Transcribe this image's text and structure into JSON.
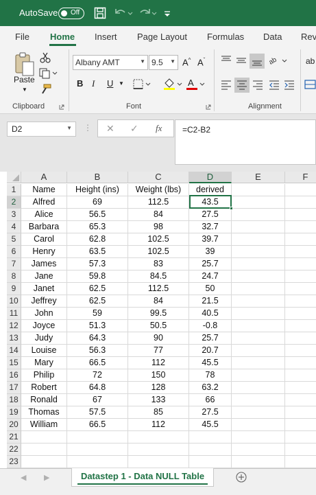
{
  "titlebar": {
    "autosave_label": "AutoSave",
    "toggle_state": "Off"
  },
  "ribbon_tabs": [
    "File",
    "Home",
    "Insert",
    "Page Layout",
    "Formulas",
    "Data",
    "Rev"
  ],
  "active_tab": "Home",
  "ribbon": {
    "paste_label": "Paste",
    "font_name": "Albany AMT",
    "font_size": "9.5",
    "bold": "B",
    "italic": "I",
    "underline": "U",
    "groups": {
      "clipboard": "Clipboard",
      "font": "Font",
      "alignment": "Alignment"
    },
    "overflow_label": "ab"
  },
  "formula_bar": {
    "name_box": "D2",
    "formula": "=C2-B2",
    "fx_label": "fx"
  },
  "sheet": {
    "columns": [
      "A",
      "B",
      "C",
      "D",
      "E",
      "F"
    ],
    "selected_column": "D",
    "selected_row": "2",
    "rows": [
      {
        "n": "1",
        "cells": [
          "Name",
          "Height (ins)",
          "Weight (lbs)",
          "derived"
        ]
      },
      {
        "n": "2",
        "cells": [
          "Alfred",
          "69",
          "112.5",
          "43.5"
        ]
      },
      {
        "n": "3",
        "cells": [
          "Alice",
          "56.5",
          "84",
          "27.5"
        ]
      },
      {
        "n": "4",
        "cells": [
          "Barbara",
          "65.3",
          "98",
          "32.7"
        ]
      },
      {
        "n": "5",
        "cells": [
          "Carol",
          "62.8",
          "102.5",
          "39.7"
        ]
      },
      {
        "n": "6",
        "cells": [
          "Henry",
          "63.5",
          "102.5",
          "39"
        ]
      },
      {
        "n": "7",
        "cells": [
          "James",
          "57.3",
          "83",
          "25.7"
        ]
      },
      {
        "n": "8",
        "cells": [
          "Jane",
          "59.8",
          "84.5",
          "24.7"
        ]
      },
      {
        "n": "9",
        "cells": [
          "Janet",
          "62.5",
          "112.5",
          "50"
        ]
      },
      {
        "n": "10",
        "cells": [
          "Jeffrey",
          "62.5",
          "84",
          "21.5"
        ]
      },
      {
        "n": "11",
        "cells": [
          "John",
          "59",
          "99.5",
          "40.5"
        ]
      },
      {
        "n": "12",
        "cells": [
          "Joyce",
          "51.3",
          "50.5",
          "-0.8"
        ]
      },
      {
        "n": "13",
        "cells": [
          "Judy",
          "64.3",
          "90",
          "25.7"
        ]
      },
      {
        "n": "14",
        "cells": [
          "Louise",
          "56.3",
          "77",
          "20.7"
        ]
      },
      {
        "n": "15",
        "cells": [
          "Mary",
          "66.5",
          "112",
          "45.5"
        ]
      },
      {
        "n": "16",
        "cells": [
          "Philip",
          "72",
          "150",
          "78"
        ]
      },
      {
        "n": "17",
        "cells": [
          "Robert",
          "64.8",
          "128",
          "63.2"
        ]
      },
      {
        "n": "18",
        "cells": [
          "Ronald",
          "67",
          "133",
          "66"
        ]
      },
      {
        "n": "19",
        "cells": [
          "Thomas",
          "57.5",
          "85",
          "27.5"
        ]
      },
      {
        "n": "20",
        "cells": [
          "William",
          "66.5",
          "112",
          "45.5"
        ]
      },
      {
        "n": "21",
        "cells": [
          "",
          "",
          "",
          ""
        ]
      },
      {
        "n": "22",
        "cells": [
          "",
          "",
          "",
          ""
        ]
      },
      {
        "n": "23",
        "cells": [
          "",
          "",
          "",
          ""
        ]
      }
    ]
  },
  "sheet_tabs": {
    "active_name": "Datastep 1 - Data NULL Table"
  },
  "colors": {
    "accent": "#217346",
    "ribbon_bg": "#f3f3f3",
    "header_bg": "#e9e9e9"
  },
  "icons": [
    "save-icon",
    "undo-icon",
    "redo-icon",
    "customize-toolbar-icon",
    "cut-icon",
    "copy-icon",
    "format-painter-icon",
    "borders-icon",
    "fill-color-icon",
    "font-color-icon",
    "increase-font-icon",
    "decrease-font-icon",
    "align-top-icon",
    "align-middle-icon",
    "align-bottom-icon",
    "orientation-icon",
    "align-left-icon",
    "align-center-icon",
    "align-right-icon",
    "decrease-indent-icon",
    "increase-indent-icon",
    "wrap-text-icon",
    "merge-icon",
    "cancel-icon",
    "enter-icon",
    "insert-function-icon",
    "add-sheet-icon",
    "scroll-left-icon",
    "scroll-right-icon"
  ]
}
